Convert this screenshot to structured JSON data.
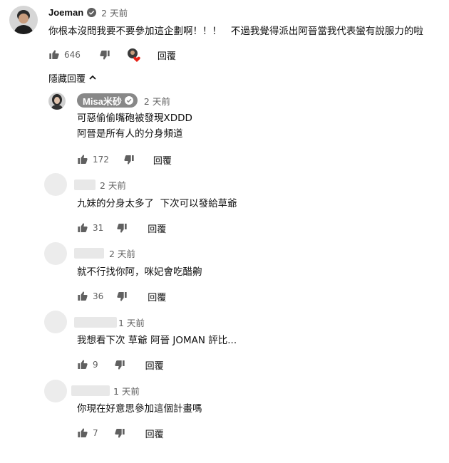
{
  "main_comment": {
    "author": "Joeman",
    "time": "2 天前",
    "text": "你根本沒問我要不要參加這企劃啊！！！   不過我覺得派出阿晉當我代表蠻有說服力的啦",
    "likes": "646",
    "reply_label": "回覆"
  },
  "toggle_replies": {
    "label": "隱藏回覆"
  },
  "replies": [
    {
      "author": "Misa米砂",
      "time": "2 天前",
      "text": "可惡偷偷嘴砲被發現XDDD\n阿晉是所有人的分身頻道",
      "likes": "172",
      "reply_label": "回覆"
    },
    {
      "author": "",
      "time": "2 天前",
      "text": "九妹的分身太多了  下次可以發給草爺",
      "likes": "31",
      "reply_label": "回覆"
    },
    {
      "author": "",
      "time": "2 天前",
      "text": "就不行找你阿，咪妃會吃醋齁",
      "likes": "36",
      "reply_label": "回覆"
    },
    {
      "author": "",
      "time": "1 天前",
      "text": "我想看下次 草爺 阿晉 JOMAN 評比...",
      "likes": "9",
      "reply_label": "回覆"
    },
    {
      "author": "",
      "time": "1 天前",
      "text": "你現在好意思參加這個計畫嗎",
      "likes": "7",
      "reply_label": "回覆"
    }
  ],
  "icons": {
    "like": "thumbs-up-icon",
    "dislike": "thumbs-down-icon",
    "verified": "verified-check-icon",
    "creator_heart": "creator-heart-icon",
    "collapse": "chevron-up-icon"
  },
  "colors": {
    "heart": "#e62117",
    "secondary_text": "#606060",
    "owner_badge": "#888888"
  }
}
